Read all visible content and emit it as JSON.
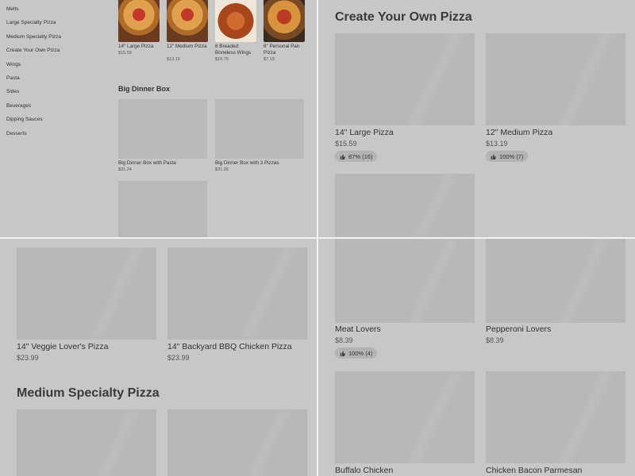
{
  "sidebar": {
    "items": [
      "Melts",
      "Large Specialty Pizza",
      "Medium Specialty Pizza",
      "Create Your Own Pizza",
      "Wings",
      "Pasta",
      "Sides",
      "Beverages",
      "Dipping Sauces",
      "Desserts"
    ]
  },
  "top_row": [
    {
      "name": "14\" Large Pizza",
      "price": "$15.59"
    },
    {
      "name": "12\" Medium Pizza",
      "price": "$13.19"
    },
    {
      "name": "8 Breaded Boneless Wings",
      "price": "$10.79"
    },
    {
      "name": "6\" Personal Pan Pizza",
      "price": "$7.19"
    }
  ],
  "big_dinner_box": {
    "title": "Big Dinner Box",
    "items": [
      {
        "name": "Big Dinner Box with Pasta",
        "price": "$31.24"
      },
      {
        "name": "Big Dinner Box with 3 Pizzas",
        "price": "$31.26"
      }
    ]
  },
  "create_your_own": {
    "title": "Create Your Own Pizza",
    "items": [
      {
        "name": "14\" Large Pizza",
        "price": "$15.59",
        "rating": "87% (16)"
      },
      {
        "name": "12\" Medium Pizza",
        "price": "$13.19",
        "rating": "100% (7)"
      }
    ]
  },
  "large_specialty": {
    "items": [
      {
        "name": "14\" Veggie Lover's Pizza",
        "price": "$23.99"
      },
      {
        "name": "14\" Backyard BBQ Chicken Pizza",
        "price": "$23.99"
      }
    ]
  },
  "medium_specialty": {
    "title": "Medium Specialty Pizza",
    "items": [
      {
        "name": "Meat Lovers",
        "price": "$8.39",
        "rating": "100% (4)"
      },
      {
        "name": "Pepperoni Lovers",
        "price": "$8.39"
      },
      {
        "name": "Buffalo Chicken"
      },
      {
        "name": "Chicken Bacon Parmesan"
      }
    ]
  },
  "icons": {
    "rating": "thumbs-up-icon"
  }
}
